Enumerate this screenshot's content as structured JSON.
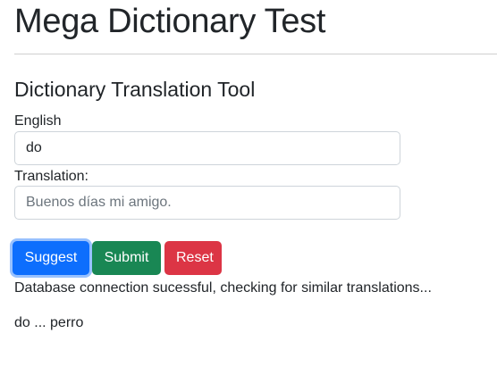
{
  "header": {
    "title": "Mega Dictionary Test"
  },
  "tool": {
    "title": "Dictionary Translation Tool",
    "english_label": "English",
    "english_value": "do",
    "translation_label": "Translation:",
    "translation_placeholder": "Buenos días mi amigo."
  },
  "buttons": {
    "suggest": "Suggest",
    "submit": "Submit",
    "reset": "Reset"
  },
  "colors": {
    "suggest": "#0d6efd",
    "submit": "#198754",
    "reset": "#dc3545"
  },
  "status": {
    "message": "Database connection sucessful, checking for similar translations..."
  },
  "results": {
    "text": "do ... perro"
  }
}
